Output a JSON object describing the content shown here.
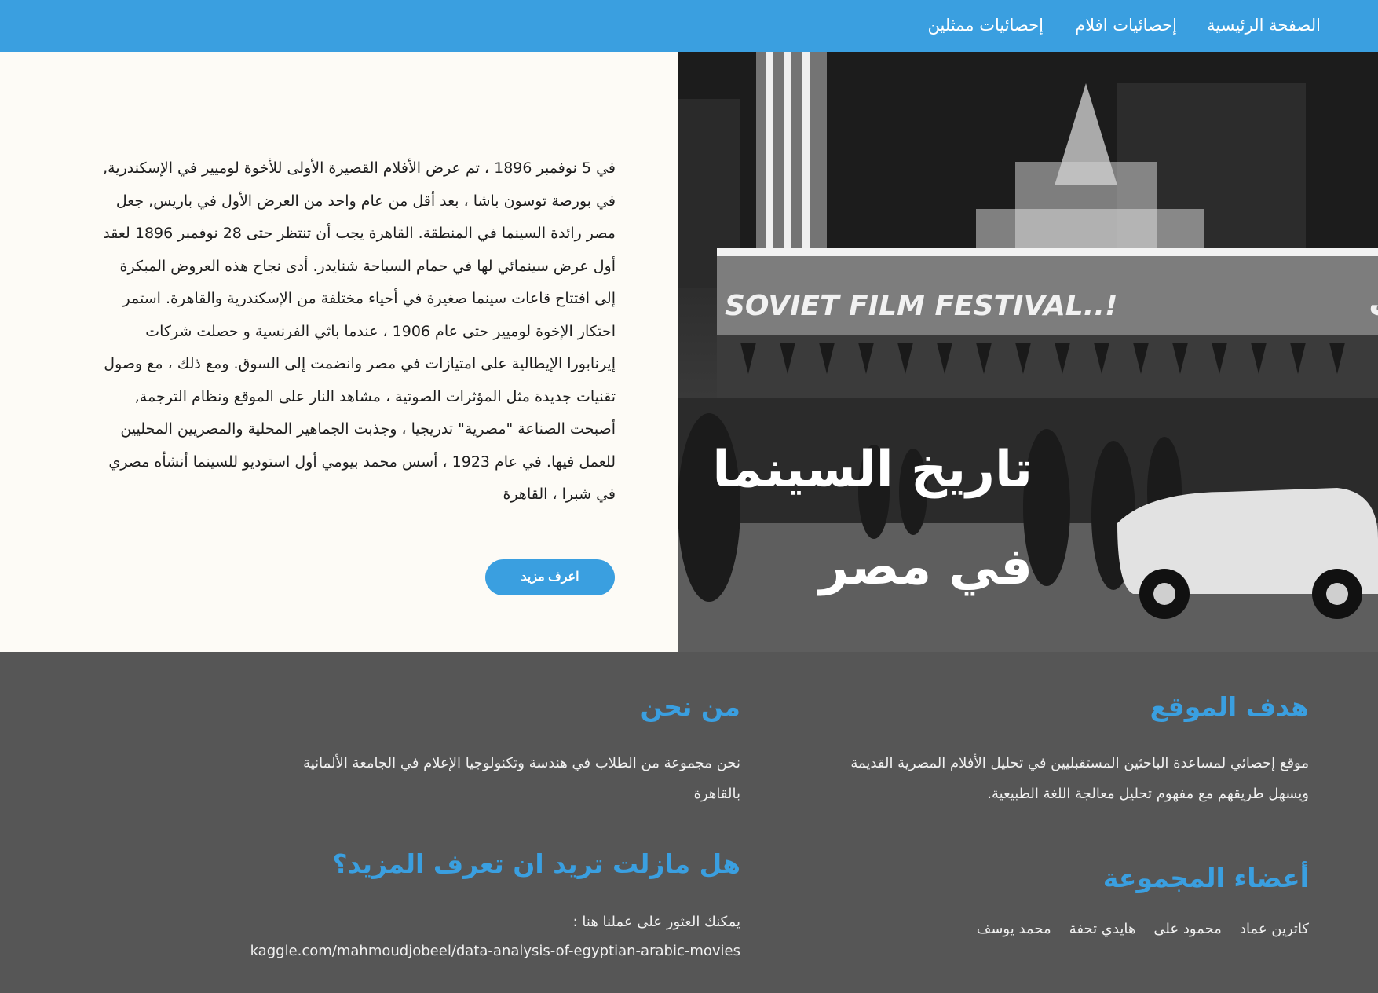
{
  "nav": {
    "home": "الصفحة الرئيسية",
    "films_stats": "إحصائيات افلام",
    "actors_stats": "إحصائيات ممثلين"
  },
  "hero": {
    "title_line1": "تاريخ السينما",
    "title_line2": "في مصر",
    "paragraph": "في 5 نوفمبر 1896 ، تم عرض الأفلام القصيرة الأولى للأخوة لوميير في الإسكندرية, في بورصة توسون باشا ، بعد أقل من عام واحد من العرض الأول في باريس, جعل مصر رائدة السينما في المنطقة. القاهرة يجب أن تنتظر حتى 28 نوفمبر 1896 لعقد أول عرض سينمائي لها في حمام السباحة شنايدر. أدى نجاح هذه العروض المبكرة إلى افتتاح قاعات سينما صغيرة في أحياء مختلفة من الإسكندرية والقاهرة. استمر احتكار الإخوة لوميير حتى عام 1906 ، عندما باثي الفرنسية و حصلت شركات إيرنابورا الإيطالية على امتيازات في مصر وانضمت إلى السوق. ومع ذلك ، مع وصول تقنيات جديدة مثل المؤثرات الصوتية ، مشاهد النار على الموقع ونظام الترجمة, أصبحت الصناعة \"مصرية\" تدريجيا ، وجذبت الجماهير المحلية والمصريين المحليين للعمل فيها. في عام 1923 ، أسس محمد بيومي أول استوديو للسينما أنشأه مصري في شبرا ، القاهرة",
    "button": "اعرف مزيد",
    "image": {
      "sign_arabic": "مهرجان الفيلم السوفييتي",
      "sign_english": "SOVIET FILM FESTIVAL..!"
    }
  },
  "footer": {
    "goal": {
      "heading": "هدف الموقع",
      "text": "موقع إحصائي لمساعدة الباحثين المستقبليين في تحليل الأفلام المصرية القديمة ويسهل طريقهم مع مفهوم تحليل معالجة اللغة الطبيعية."
    },
    "about": {
      "heading": "من نحن",
      "text": "نحن مجموعة من الطلاب في هندسة وتكنولوجيا الإعلام في الجامعة الألمانية بالقاهرة"
    },
    "members": {
      "heading": "أعضاء المجموعة",
      "names": [
        "كاترين عماد",
        "محمود على",
        "هايدي تحفة",
        "محمد يوسف"
      ]
    },
    "more": {
      "heading": "هل مازلت تريد ان تعرف المزيد؟",
      "text": "يمكنك العثور على عملنا هنا :",
      "link": "kaggle.com/mahmoudjobeel/data-analysis-of-egyptian-arabic-movies"
    }
  },
  "colors": {
    "accent": "#3a9fe0",
    "hero_text_bg": "#fdfbf6",
    "footer_bg": "#565656"
  }
}
